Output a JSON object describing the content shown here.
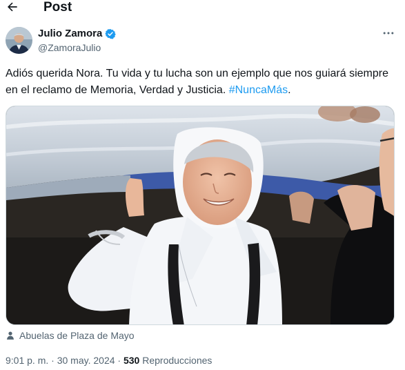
{
  "header": {
    "title": "Post",
    "back_icon": "arrow-left-icon"
  },
  "author": {
    "name": "Julio Zamora",
    "handle": "@ZamoraJulio",
    "verified_icon": "verified-badge-icon",
    "verified_color": "#1d9bf0"
  },
  "tweet": {
    "text": "Adiós querida Nora. Tu vida y tu lucha son un ejemplo que nos guiará siempre en el reclamo de Memoria, Verdad y Justicia.",
    "hashtag": "#NuncaMás",
    "trailing": "."
  },
  "media": {
    "tagged_icon": "person-icon",
    "tagged": "Abuelas de Plaza de Mayo"
  },
  "meta": {
    "time": "9:01 p. m.",
    "separator": "·",
    "date": "30 may. 2024",
    "views_count": "530",
    "views_label": "Reproducciones"
  },
  "colors": {
    "accent": "#1d9bf0",
    "text": "#0f1419",
    "muted": "#536471"
  }
}
